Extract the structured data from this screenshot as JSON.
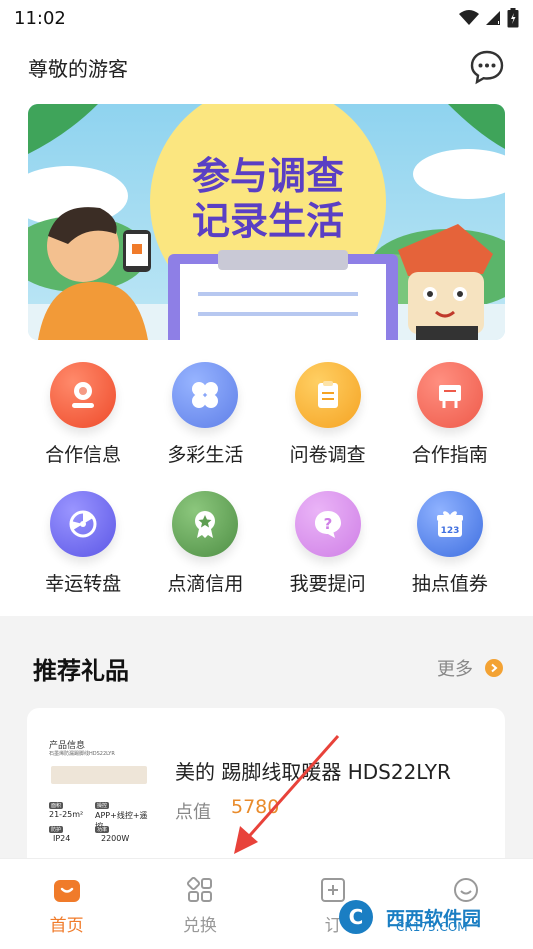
{
  "status_bar": {
    "time": "11:02"
  },
  "header": {
    "greeting": "尊敬的游客"
  },
  "banner": {
    "line1": "参与调查",
    "line2": "记录生活"
  },
  "grid": [
    {
      "label": "合作信息",
      "icon": "person-circle-icon",
      "color": "#F25A3C"
    },
    {
      "label": "多彩生活",
      "icon": "four-petal-icon",
      "color": "#6B8CF0"
    },
    {
      "label": "问卷调查",
      "icon": "clipboard-icon",
      "color": "#F5A623"
    },
    {
      "label": "合作指南",
      "icon": "guide-board-icon",
      "color": "#F06B5A"
    },
    {
      "label": "幸运转盘",
      "icon": "wheel-icon",
      "color": "#6E6AF0"
    },
    {
      "label": "点滴信用",
      "icon": "medal-icon",
      "color": "#5E9E52"
    },
    {
      "label": "我要提问",
      "icon": "question-bubble-icon",
      "color": "#D387E8"
    },
    {
      "label": "抽点值券",
      "icon": "gift-123-icon",
      "color": "#4A7CE6"
    }
  ],
  "section": {
    "title": "推荐礼品",
    "more_label": "更多"
  },
  "product": {
    "name": "美的 踢脚线取暖器 HDS22LYR",
    "price_label": "点值",
    "price_value": "5780",
    "thumb_title": "产品信息",
    "thumb_subtitle": "石墨烯防漏踢脚线HDS22LYR",
    "spec_area": "21-25m²",
    "spec_control": "APP+线控+遥控",
    "spec_ip": "IP24",
    "spec_power": "2200W"
  },
  "tabs": [
    {
      "label": "首页",
      "active": true
    },
    {
      "label": "兑换",
      "active": false
    },
    {
      "label": "订",
      "active": false
    },
    {
      "label": "",
      "active": false
    }
  ],
  "watermark": {
    "brand": "西西软件园",
    "url": "CR173.COM"
  },
  "colors": {
    "accent": "#F07B2A",
    "price": "#E98B2B"
  }
}
